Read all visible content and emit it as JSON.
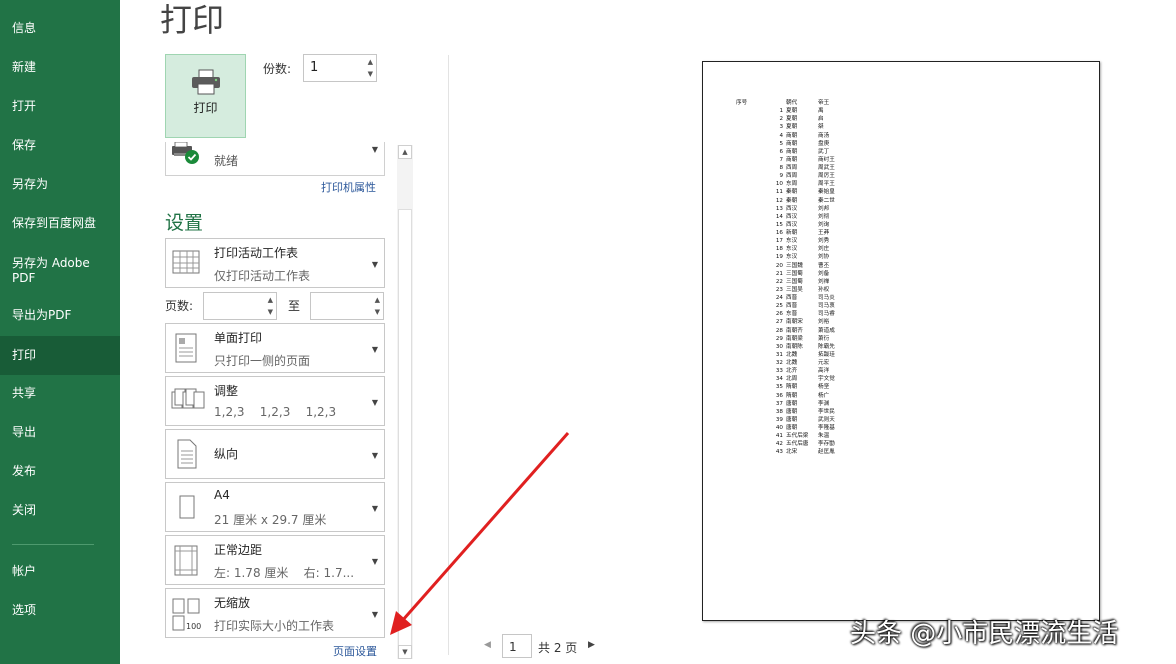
{
  "sidebar": {
    "items": [
      {
        "label": "信息"
      },
      {
        "label": "新建"
      },
      {
        "label": "打开"
      },
      {
        "label": "保存"
      },
      {
        "label": "另存为"
      },
      {
        "label": "保存到百度网盘"
      },
      {
        "label": "另存为 Adobe PDF"
      },
      {
        "label": "导出为PDF"
      },
      {
        "label": "打印"
      },
      {
        "label": "共享"
      },
      {
        "label": "导出"
      },
      {
        "label": "发布"
      },
      {
        "label": "关闭"
      },
      {
        "label": "帐户"
      },
      {
        "label": "选项"
      }
    ],
    "active": "打印"
  },
  "title": "打印",
  "print_button": {
    "label": "打印"
  },
  "copies": {
    "label": "份数:",
    "value": "1"
  },
  "printer": {
    "status": "就绪",
    "properties_link": "打印机属性"
  },
  "settings": {
    "title": "设置",
    "what": {
      "main": "打印活动工作表",
      "sub": "仅打印活动工作表"
    },
    "pages": {
      "label": "页数:",
      "from": "",
      "to_label": "至",
      "to": ""
    },
    "sides": {
      "main": "单面打印",
      "sub": "只打印一侧的页面"
    },
    "collate": {
      "main": "调整",
      "sub": "1,2,3    1,2,3    1,2,3"
    },
    "orientation": {
      "main": "纵向"
    },
    "paper": {
      "main": "A4",
      "sub": "21 厘米 x 29.7 厘米"
    },
    "margins": {
      "main": "正常边距",
      "sub": "左: 1.78 厘米    右: 1.7..."
    },
    "scaling": {
      "main": "无缩放",
      "sub": "打印实际大小的工作表"
    },
    "page_setup_link": "页面设置"
  },
  "pager": {
    "current": "1",
    "total_text": "共 2 页"
  },
  "preview": {
    "headers": {
      "no": "序号",
      "era": "朝代",
      "name": "帝王"
    },
    "rows": [
      {
        "no": "1",
        "era": "夏朝",
        "name": "禹"
      },
      {
        "no": "2",
        "era": "夏朝",
        "name": "启"
      },
      {
        "no": "3",
        "era": "夏朝",
        "name": "桀"
      },
      {
        "no": "4",
        "era": "商朝",
        "name": "商汤"
      },
      {
        "no": "5",
        "era": "商朝",
        "name": "盘庚"
      },
      {
        "no": "6",
        "era": "商朝",
        "name": "武丁"
      },
      {
        "no": "7",
        "era": "商朝",
        "name": "商纣王"
      },
      {
        "no": "8",
        "era": "西周",
        "name": "周武王"
      },
      {
        "no": "9",
        "era": "西周",
        "name": "周厉王"
      },
      {
        "no": "10",
        "era": "东周",
        "name": "周平王"
      },
      {
        "no": "11",
        "era": "秦朝",
        "name": "秦始皇"
      },
      {
        "no": "12",
        "era": "秦朝",
        "name": "秦二世"
      },
      {
        "no": "13",
        "era": "西汉",
        "name": "刘邦"
      },
      {
        "no": "14",
        "era": "西汉",
        "name": "刘彻"
      },
      {
        "no": "15",
        "era": "西汉",
        "name": "刘询"
      },
      {
        "no": "16",
        "era": "新朝",
        "name": "王莽"
      },
      {
        "no": "17",
        "era": "东汉",
        "name": "刘秀"
      },
      {
        "no": "18",
        "era": "东汉",
        "name": "刘庄"
      },
      {
        "no": "19",
        "era": "东汉",
        "name": "刘协"
      },
      {
        "no": "20",
        "era": "三国魏",
        "name": "曹丕"
      },
      {
        "no": "21",
        "era": "三国蜀",
        "name": "刘备"
      },
      {
        "no": "22",
        "era": "三国蜀",
        "name": "刘禅"
      },
      {
        "no": "23",
        "era": "三国吴",
        "name": "孙权"
      },
      {
        "no": "24",
        "era": "西晋",
        "name": "司马炎"
      },
      {
        "no": "25",
        "era": "西晋",
        "name": "司马衷"
      },
      {
        "no": "26",
        "era": "东晋",
        "name": "司马睿"
      },
      {
        "no": "27",
        "era": "南朝宋",
        "name": "刘裕"
      },
      {
        "no": "28",
        "era": "南朝齐",
        "name": "萧道成"
      },
      {
        "no": "29",
        "era": "南朝梁",
        "name": "萧衍"
      },
      {
        "no": "30",
        "era": "南朝陈",
        "name": "陈霸先"
      },
      {
        "no": "31",
        "era": "北魏",
        "name": "拓跋珪"
      },
      {
        "no": "32",
        "era": "北魏",
        "name": "元宏"
      },
      {
        "no": "33",
        "era": "北齐",
        "name": "高洋"
      },
      {
        "no": "34",
        "era": "北周",
        "name": "宇文觉"
      },
      {
        "no": "35",
        "era": "隋朝",
        "name": "杨坚"
      },
      {
        "no": "36",
        "era": "隋朝",
        "name": "杨广"
      },
      {
        "no": "37",
        "era": "唐朝",
        "name": "李渊"
      },
      {
        "no": "38",
        "era": "唐朝",
        "name": "李世民"
      },
      {
        "no": "39",
        "era": "唐朝",
        "name": "武则天"
      },
      {
        "no": "40",
        "era": "唐朝",
        "name": "李隆基"
      },
      {
        "no": "41",
        "era": "五代后梁",
        "name": "朱温"
      },
      {
        "no": "42",
        "era": "五代后唐",
        "name": "李存勖"
      },
      {
        "no": "43",
        "era": "北宋",
        "name": "赵匡胤"
      }
    ]
  },
  "watermark": "头条 @小市民漂流生活"
}
